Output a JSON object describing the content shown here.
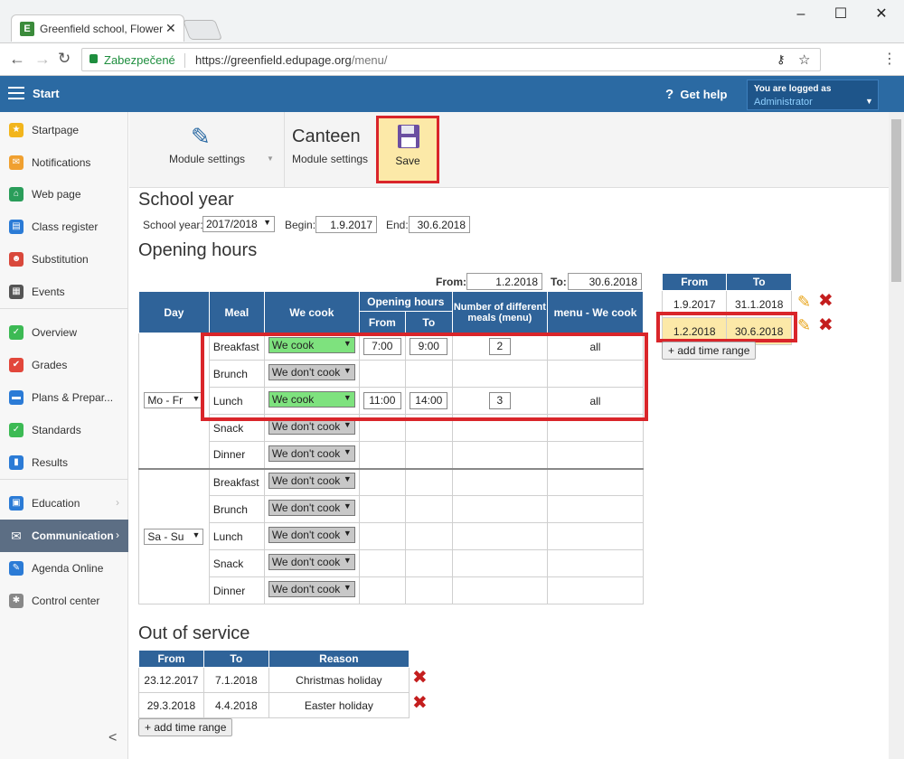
{
  "browser": {
    "tab_title": "Greenfield school, Flower",
    "favicon": "E",
    "secure_label": "Zabezpečené",
    "url_base": "https://greenfield.edupage.org",
    "url_path": "/menu/"
  },
  "topbar": {
    "start_label": "Start",
    "help_label": "Get help",
    "login_line1": "You are logged as",
    "login_line2": "Administrator"
  },
  "sidebar": {
    "items": [
      {
        "label": "Startpage",
        "icon": "star-icon",
        "color": "#f2b51c"
      },
      {
        "label": "Notifications",
        "icon": "envelope-icon",
        "color": "#f0a030"
      },
      {
        "label": "Web page",
        "icon": "home-icon",
        "color": "#2a9d5a"
      },
      {
        "label": "Class register",
        "icon": "book-icon",
        "color": "#2b7bd6"
      },
      {
        "label": "Substitution",
        "icon": "user-swap-icon",
        "color": "#d9483b"
      },
      {
        "label": "Events",
        "icon": "calendar-icon",
        "color": "#555555"
      },
      {
        "label": "Overview",
        "icon": "check-circle-icon",
        "color": "#3cba54"
      },
      {
        "label": "Grades",
        "icon": "grades-icon",
        "color": "#e2473b"
      },
      {
        "label": "Plans & Prepar...",
        "icon": "briefcase-icon",
        "color": "#2b7bd6"
      },
      {
        "label": "Standards",
        "icon": "shield-check-icon",
        "color": "#3cba54"
      },
      {
        "label": "Results",
        "icon": "bar-chart-icon",
        "color": "#2b7bd6"
      },
      {
        "label": "Education",
        "icon": "education-icon",
        "color": "#2b7bd6"
      },
      {
        "label": "Communication",
        "icon": "chat-icon",
        "color": "#ffffff"
      },
      {
        "label": "Agenda Online",
        "icon": "pen-icon",
        "color": "#2b7bd6"
      },
      {
        "label": "Control center",
        "icon": "gear-icon",
        "color": "#888888"
      }
    ],
    "collapse_glyph": "<"
  },
  "toolbar": {
    "module_settings_label": "Module settings",
    "canteen_title": "Canteen",
    "canteen_sub": "Module settings",
    "save_label": "Save"
  },
  "school_year": {
    "heading": "School year",
    "year_label": "School year:",
    "year_value": "2017/2018",
    "begin_label": "Begin:",
    "begin_value": "1.9.2017",
    "end_label": "End:",
    "end_value": "30.6.2018"
  },
  "opening": {
    "heading": "Opening hours",
    "from_label": "From:",
    "from_value": "1.2.2018",
    "to_label": "To:",
    "to_value": "30.6.2018",
    "headers": {
      "day": "Day",
      "meal": "Meal",
      "we_cook": "We cook",
      "opening_hours": "Opening hours",
      "from": "From",
      "to": "To",
      "num_meals": "Number of different meals (menu)",
      "menu_we_cook": "menu - We cook"
    },
    "groups": [
      {
        "day": "Mo - Fr",
        "rows": [
          {
            "meal": "Breakfast",
            "cook": "We cook",
            "yes": true,
            "from": "7:00",
            "to": "9:00",
            "num": "2",
            "menu": "all"
          },
          {
            "meal": "Brunch",
            "cook": "We don't cook",
            "yes": false,
            "from": "",
            "to": "",
            "num": "",
            "menu": ""
          },
          {
            "meal": "Lunch",
            "cook": "We cook",
            "yes": true,
            "from": "11:00",
            "to": "14:00",
            "num": "3",
            "menu": "all"
          },
          {
            "meal": "Snack",
            "cook": "We don't cook",
            "yes": false,
            "from": "",
            "to": "",
            "num": "",
            "menu": ""
          },
          {
            "meal": "Dinner",
            "cook": "We don't cook",
            "yes": false,
            "from": "",
            "to": "",
            "num": "",
            "menu": ""
          }
        ]
      },
      {
        "day": "Sa - Su",
        "rows": [
          {
            "meal": "Breakfast",
            "cook": "We don't cook",
            "yes": false
          },
          {
            "meal": "Brunch",
            "cook": "We don't cook",
            "yes": false
          },
          {
            "meal": "Lunch",
            "cook": "We don't cook",
            "yes": false
          },
          {
            "meal": "Snack",
            "cook": "We don't cook",
            "yes": false
          },
          {
            "meal": "Dinner",
            "cook": "We don't cook",
            "yes": false
          }
        ]
      }
    ]
  },
  "ranges": {
    "from_header": "From",
    "to_header": "To",
    "rows": [
      {
        "from": "1.9.2017",
        "to": "31.1.2018"
      },
      {
        "from": "1.2.2018",
        "to": "30.6.2018"
      }
    ],
    "add_label": "+ add time range"
  },
  "out_of_service": {
    "heading": "Out of service",
    "headers": {
      "from": "From",
      "to": "To",
      "reason": "Reason"
    },
    "rows": [
      {
        "from": "23.12.2017",
        "to": "7.1.2018",
        "reason": "Christmas holiday"
      },
      {
        "from": "29.3.2018",
        "to": "4.4.2018",
        "reason": "Easter holiday"
      }
    ],
    "add_label": "+ add time range"
  },
  "colors": {
    "accent": "#2b6aa3",
    "header": "#2f6399",
    "highlight": "#d9252a"
  }
}
